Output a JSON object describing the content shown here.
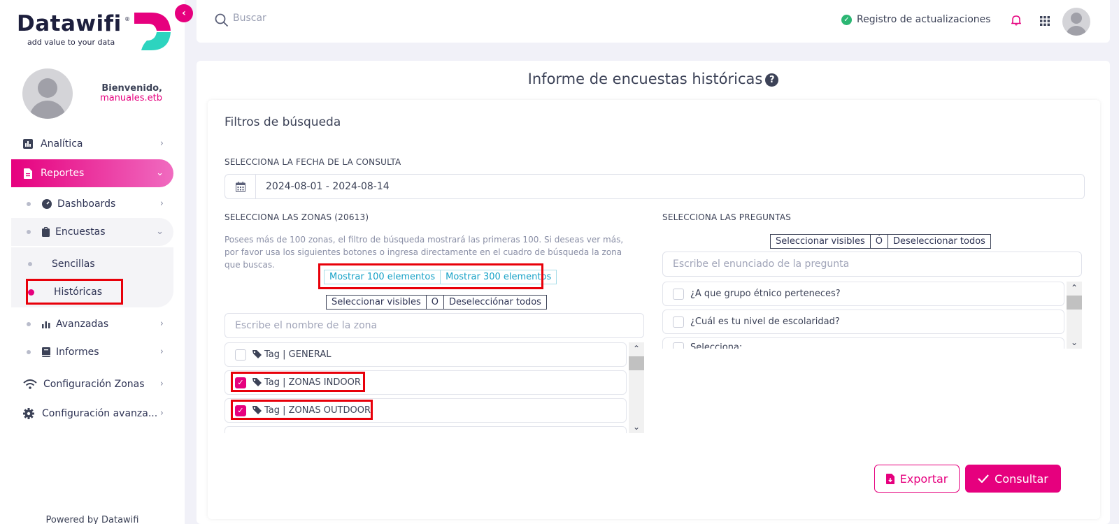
{
  "brand": {
    "name": "Datawifi",
    "registered": "®",
    "tagline": "add value to your data",
    "accent": "#e6007e",
    "teal": "#2dd4bf"
  },
  "sidebar": {
    "welcome": "Bienvenido,",
    "username": "manuales.etb",
    "items": [
      {
        "label": "Analítica",
        "icon": "chart-bar-icon"
      },
      {
        "label": "Reportes",
        "icon": "file-icon"
      },
      {
        "label": "Dashboards",
        "icon": "gauge-icon"
      },
      {
        "label": "Encuestas",
        "icon": "clipboard-icon"
      },
      {
        "label": "Sencillas"
      },
      {
        "label": "Históricas"
      },
      {
        "label": "Avanzadas",
        "icon": "bar-chart-icon"
      },
      {
        "label": "Informes",
        "icon": "book-icon"
      },
      {
        "label": "Configuración Zonas",
        "icon": "wifi-icon"
      },
      {
        "label": "Configuración avanza...",
        "icon": "gear-icon"
      }
    ],
    "footer": "Powered by Datawifi"
  },
  "header": {
    "search_placeholder": "Buscar",
    "updates_label": "Registro de actualizaciones"
  },
  "main": {
    "title": "Informe de encuestas históricas",
    "filters_title": "Filtros de búsqueda",
    "date_label": "SELECCIONA LA FECHA DE LA CONSULTA",
    "date_value": "2024-08-01 - 2024-08-14",
    "zones_label": "SELECCIONA LAS ZONAS (20613)",
    "zones_note": "Posees más de 100 zonas, el filtro de búsqueda mostrará las primeras 100. Si deseas ver más, por favor usa los siguientes botones o ingresa directamente en el cuadro de búsqueda la zona que buscas.",
    "show_100": "Mostrar 100 elementos",
    "show_300": "Mostrar 300 elementos",
    "select_visible": "Seleccionar visibles",
    "or_zones": "O",
    "deselect_all": "Deselecciónar todos",
    "zone_search_placeholder": "Escribe el nombre de la zona",
    "zones": [
      {
        "label": "Tag | GENERAL",
        "checked": false
      },
      {
        "label": "Tag | ZONAS INDOOR",
        "checked": true
      },
      {
        "label": "Tag | ZONAS OUTDOOR",
        "checked": true
      }
    ],
    "questions_label": "SELECCIONA LAS PREGUNTAS",
    "q_select_visible": "Seleccionar visibles",
    "or_questions": "Ó",
    "q_deselect_all": "Deseleccionar todos",
    "question_search_placeholder": "Escribe el enunciado de la pregunta",
    "questions": [
      {
        "label": "¿A que grupo étnico perteneces?",
        "checked": false
      },
      {
        "label": "¿Cuál es tu nivel de escolaridad?",
        "checked": false
      },
      {
        "label": "Selecciona:",
        "checked": false
      }
    ],
    "export_label": "Exportar",
    "consult_label": "Consultar"
  }
}
